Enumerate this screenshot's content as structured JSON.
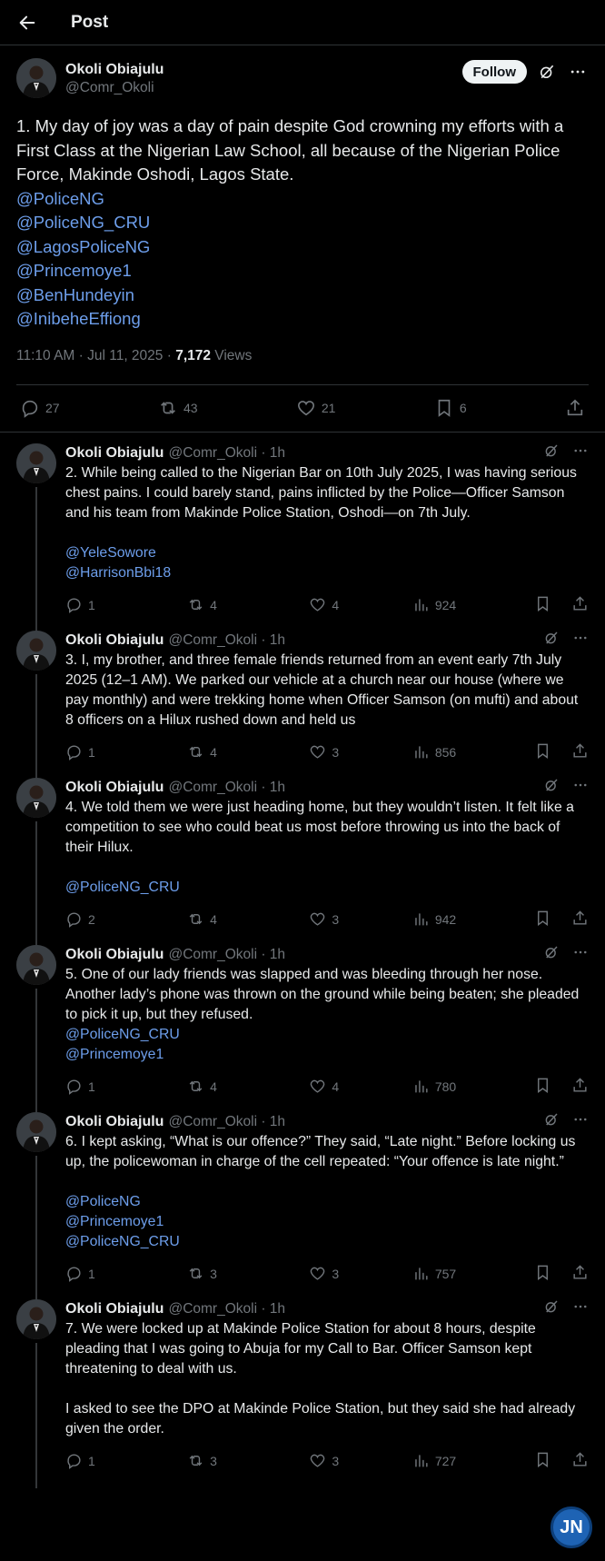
{
  "topbar": {
    "title": "Post"
  },
  "main_post": {
    "author_name": "Okoli Obiajulu",
    "author_handle": "@Comr_Okoli",
    "follow_label": "Follow",
    "text": "1. My day of joy was a day of pain despite God crowning my efforts with a First Class at the Nigerian Law School, all because of the Nigerian Police Force, Makinde Oshodi, Lagos State.",
    "mentions": [
      "@PoliceNG",
      "@PoliceNG_CRU",
      "@LagosPoliceNG",
      "@Princemoye1",
      "@BenHundeyin",
      "@InibeheEffiong"
    ],
    "timestamp": "11:10 AM · Jul 11, 2025 · ",
    "views_count": "7,172",
    "views_label": " Views",
    "replies": "27",
    "reposts": "43",
    "likes": "21",
    "bookmarks": "6"
  },
  "replies": [
    {
      "name": "Okoli Obiajulu",
      "handle": "@Comr_Okoli · 1h",
      "paragraphs": [
        "2. While being called to the Nigerian Bar on 10th July 2025, I was having serious chest pains. I could barely stand, pains inflicted by the Police—Officer Samson and his team from Makinde Police Station, Oshodi—on 7th July.",
        ""
      ],
      "mentions": [
        "@YeleSowore",
        "@HarrisonBbi18"
      ],
      "replies": "1",
      "reposts": "4",
      "likes": "4",
      "views": "924"
    },
    {
      "name": "Okoli Obiajulu",
      "handle": "@Comr_Okoli · 1h",
      "paragraphs": [
        "3. I, my brother, and three female friends returned from an event early 7th July 2025 (12–1 AM). We parked our vehicle at a church near our house (where we pay monthly) and were trekking home when Officer Samson (on mufti) and about 8 officers on a Hilux rushed down and held us"
      ],
      "mentions": [],
      "replies": "1",
      "reposts": "4",
      "likes": "3",
      "views": "856"
    },
    {
      "name": "Okoli Obiajulu",
      "handle": "@Comr_Okoli · 1h",
      "paragraphs": [
        "4. We told them we were just heading home, but they wouldn’t listen. It felt like a competition to see who could beat us most before throwing us into the back of their Hilux.",
        ""
      ],
      "mentions": [
        "@PoliceNG_CRU"
      ],
      "replies": "2",
      "reposts": "4",
      "likes": "3",
      "views": "942"
    },
    {
      "name": "Okoli Obiajulu",
      "handle": "@Comr_Okoli · 1h",
      "paragraphs": [
        "5. One of our lady friends was slapped and was bleeding through her nose. Another lady’s phone was thrown on the ground while being beaten; she pleaded to pick it up, but they refused."
      ],
      "mentions": [
        "@PoliceNG_CRU",
        "@Princemoye1"
      ],
      "replies": "1",
      "reposts": "4",
      "likes": "4",
      "views": "780"
    },
    {
      "name": "Okoli Obiajulu",
      "handle": "@Comr_Okoli · 1h",
      "paragraphs": [
        "6. I kept asking, “What is our offence?” They said, “Late night.” Before locking us up, the policewoman in charge of the cell repeated: “Your offence is late night.”",
        ""
      ],
      "mentions": [
        "@PoliceNG",
        "@Princemoye1",
        "@PoliceNG_CRU"
      ],
      "replies": "1",
      "reposts": "3",
      "likes": "3",
      "views": "757"
    },
    {
      "name": "Okoli Obiajulu",
      "handle": "@Comr_Okoli · 1h",
      "paragraphs": [
        "7. We were locked up at Makinde Police Station for about 8 hours, despite pleading that I was going to Abuja for my Call to Bar. Officer Samson kept threatening to deal with us.",
        "",
        " I asked to see the DPO at Makinde Police Station, but they said she had already given the order."
      ],
      "mentions": [],
      "replies": "1",
      "reposts": "3",
      "likes": "3",
      "views": "727"
    }
  ],
  "watermark": {
    "text": "JN"
  }
}
